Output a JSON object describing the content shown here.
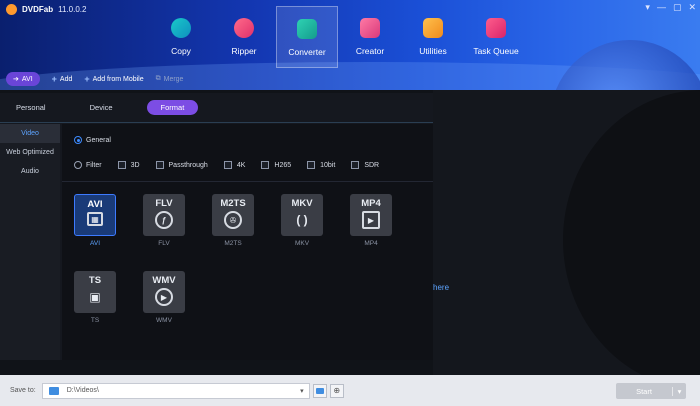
{
  "app": {
    "name": "DVDFab",
    "version": "11.0.0.2"
  },
  "window_controls": [
    "▾",
    "—",
    "▢",
    "✕"
  ],
  "modules": [
    {
      "label": "Copy",
      "icon": "copy-icon",
      "active": false
    },
    {
      "label": "Ripper",
      "icon": "ripper-icon",
      "active": false
    },
    {
      "label": "Converter",
      "icon": "converter-icon",
      "active": true
    },
    {
      "label": "Creator",
      "icon": "creator-icon",
      "active": false
    },
    {
      "label": "Utilities",
      "icon": "utilities-icon",
      "active": false
    },
    {
      "label": "Task Queue",
      "icon": "task-queue-icon",
      "active": false
    }
  ],
  "toolbar": {
    "profile": "AVI",
    "add": "Add",
    "add_mobile": "Add from Mobile",
    "merge": "Merge"
  },
  "profile_tabs": [
    "Personal",
    "Device",
    "Format"
  ],
  "sidebar": [
    "Video",
    "Web Optimized",
    "Audio"
  ],
  "options": {
    "general": "General",
    "filter": "Filter",
    "checks": [
      "3D",
      "Passthrough",
      "4K",
      "H265",
      "10bit",
      "SDR"
    ]
  },
  "formats": [
    {
      "code": "AVI",
      "caption": "AVI",
      "glyph": "film-icon",
      "active": true
    },
    {
      "code": "FLV",
      "caption": "FLV",
      "glyph": "flash-icon",
      "active": false
    },
    {
      "code": "M2TS",
      "caption": "M2TS",
      "glyph": "reel-icon",
      "active": false
    },
    {
      "code": "MKV",
      "caption": "MKV",
      "glyph": "mkv-icon",
      "active": false
    },
    {
      "code": "MP4",
      "caption": "MP4",
      "glyph": "play-icon",
      "active": false
    },
    {
      "code": "TS",
      "caption": "TS",
      "glyph": "camera-icon",
      "active": false
    },
    {
      "code": "WMV",
      "caption": "WMV",
      "glyph": "play-icon",
      "active": false
    }
  ],
  "right_link": "here",
  "bottom": {
    "save_to_label": "Save to:",
    "path": "D:\\Videos\\",
    "start": "Start"
  }
}
